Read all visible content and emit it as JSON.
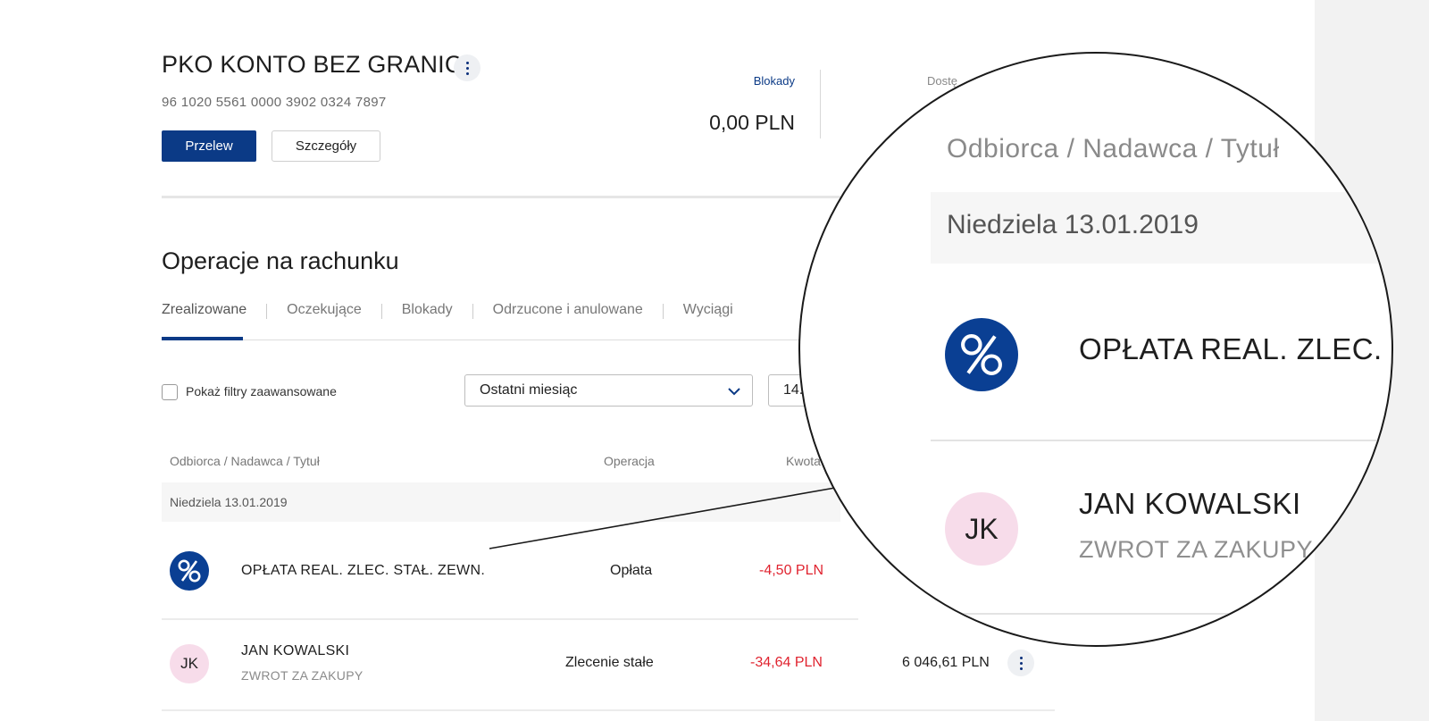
{
  "account": {
    "name": "PKO KONTO BEZ GRANIC",
    "number": "96 1020 5561 0000 3902 0324 7897",
    "transfer_button": "Przelew",
    "details_button": "Szczegóły",
    "blocks_label": "Blokady",
    "blocks_value": "0,00 PLN",
    "available_label": "Dostę"
  },
  "operations": {
    "title": "Operacje na rachunku",
    "tabs": [
      {
        "label": "Zrealizowane",
        "active": true
      },
      {
        "label": "Oczekujące",
        "active": false
      },
      {
        "label": "Blokady",
        "active": false
      },
      {
        "label": "Odrzucone i anulowane",
        "active": false
      },
      {
        "label": "Wyciągi",
        "active": false
      }
    ],
    "filters": {
      "advanced_label": "Pokaż filtry zaawansowane",
      "advanced_checked": false,
      "period_value": "Ostatni miesiąc",
      "date_from_value": "14."
    },
    "columns": {
      "party": "Odbiorca / Nadawca / Tytuł",
      "operation": "Operacja",
      "amount": "Kwota"
    },
    "date_group": "Niedziela 13.01.2019",
    "rows": [
      {
        "avatar": "%",
        "avatar_icon": "percent-icon",
        "title": "OPŁATA REAL. ZLEC. STAŁ. ZEWN.",
        "subtitle": "",
        "operation": "Opłata",
        "amount": "-4,50 PLN",
        "balance": ""
      },
      {
        "avatar": "JK",
        "avatar_icon": "",
        "title": "JAN KOWALSKI",
        "subtitle": "ZWROT ZA ZAKUPY",
        "operation": "Zlecenie stałe",
        "amount": "-34,64 PLN",
        "balance": "6 046,61 PLN"
      }
    ]
  },
  "magnifier": {
    "header": "Odbiorca / Nadawca / Tytuł",
    "date": "Niedziela 13.01.2019",
    "row1_title": "OPŁATA REAL. ZLEC. STAŁ.",
    "row2_avatar": "JK",
    "row2_title": "JAN KOWALSKI",
    "row2_subtitle": "ZWROT ZA ZAKUPY"
  },
  "colors": {
    "brand_navy": "#0b3a86",
    "negative_amount": "#e0232f",
    "avatar_pink": "#f7dcea",
    "avatar_blue": "#0a3f93"
  }
}
